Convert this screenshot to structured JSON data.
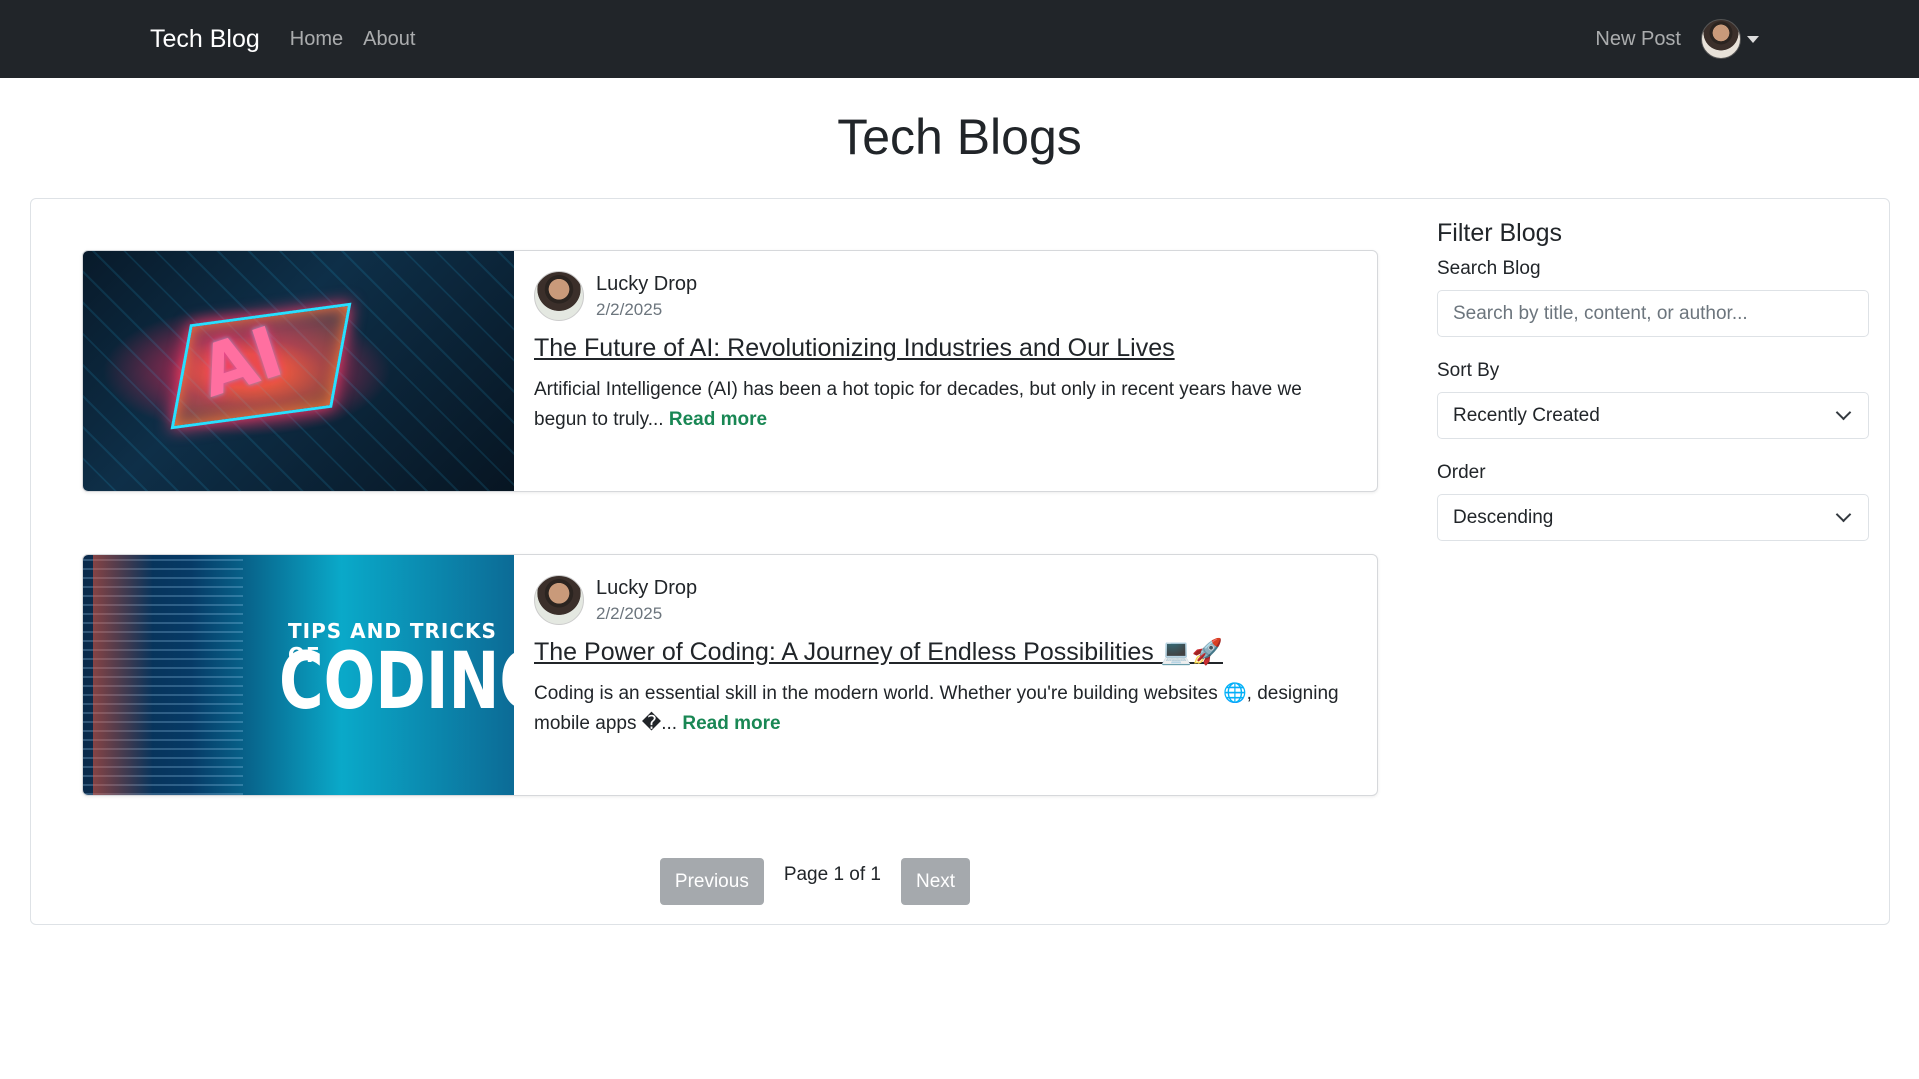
{
  "nav": {
    "brand": "Tech Blog",
    "links": [
      "Home",
      "About"
    ],
    "new_post": "New Post"
  },
  "page": {
    "title": "Tech Blogs"
  },
  "posts": [
    {
      "author": "Lucky Drop",
      "date": "2/2/2025",
      "title": "The Future of AI: Revolutionizing Industries and Our Lives",
      "excerpt": "Artificial Intelligence (AI) has been a hot topic for decades, but only in recent years have we begun to truly...",
      "read_more": "Read more",
      "image_text": "AI"
    },
    {
      "author": "Lucky Drop",
      "date": "2/2/2025",
      "title": "The Power of Coding: A Journey of Endless Possibilities 💻🚀",
      "excerpt": "Coding is an essential skill in the modern world. Whether you're building websites 🌐, designing mobile apps �...",
      "read_more": "Read more",
      "image_text_small": "TIPS AND TRICKS OF",
      "image_text_large": "CODING"
    }
  ],
  "pagination": {
    "previous": "Previous",
    "info": "Page 1 of 1",
    "next": "Next"
  },
  "filter": {
    "heading": "Filter Blogs",
    "search_label": "Search Blog",
    "search_placeholder": "Search by title, content, or author...",
    "sort_label": "Sort By",
    "sort_value": "Recently Created",
    "order_label": "Order",
    "order_value": "Descending"
  },
  "colors": {
    "navbar": "#212529",
    "read_more": "#198754",
    "pagination_button": "#a5a9ad"
  }
}
